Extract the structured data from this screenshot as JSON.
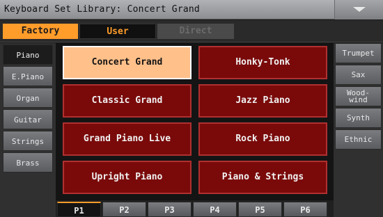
{
  "title": "Keyboard Set Library: Concert Grand",
  "tabs": [
    "Factory",
    "User",
    "Direct"
  ],
  "left_categories": [
    "Piano",
    "E.Piano",
    "Organ",
    "Guitar",
    "Strings",
    "Brass"
  ],
  "right_categories": [
    "Trumpet",
    "Sax",
    "Wood-\nwind",
    "Synth",
    "Ethnic"
  ],
  "sounds": [
    "Concert Grand",
    "Honky-Tonk",
    "Classic Grand",
    "Jazz Piano",
    "Grand Piano Live",
    "Rock Piano",
    "Upright Piano",
    "Piano & Strings"
  ],
  "selected_sound": "Concert Grand",
  "pages": [
    "P1",
    "P2",
    "P3",
    "P4",
    "P5",
    "P6"
  ],
  "active_page": "P1",
  "colors": {
    "accent": "#ff9c2a",
    "sound_bg": "#7a0a0a",
    "selected_bg": "#ffc08a"
  },
  "icons": {
    "menu": "triangle-down-icon"
  }
}
